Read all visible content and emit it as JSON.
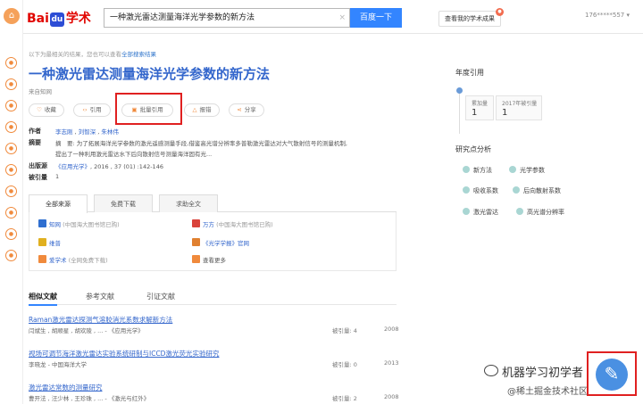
{
  "header": {
    "logo_bai": "Bai",
    "logo_du": "du",
    "logo_xueshu": "学术",
    "search_value": "一种激光雷达测量海洋光学参数的新方法",
    "search_button": "百度一下",
    "my_results": "查看我的学术成果",
    "user": "176*****557"
  },
  "hint": {
    "text": "以下为最相关的结果，您也可以查看",
    "link": "全部搜索结果"
  },
  "paper": {
    "title": "一种激光雷达测量海洋光学参数的新方法",
    "source": "来自知网",
    "actions": [
      "收藏",
      "引用",
      "批量引用",
      "报错",
      "分享"
    ],
    "authors_label": "作者",
    "authors": [
      "李志刚",
      "刘智深",
      "朱林伟"
    ],
    "abstract_label": "摘要",
    "abstract_line1": "摘　要: 为了拓展海洋光学参数的激光遥感测量手段,借鉴高光谱分辨率多普勒激光雷达对大气散射信号的测量机制,",
    "abstract_line2": "提出了一种利用激光雷达水下后向散射信号测量海洋固有光...",
    "pub_label": "出版源",
    "pub_journal": "《应用光学》",
    "pub_detail": ", 2016 , 37 (01) :142-146",
    "cited_label": "被引量",
    "cited_value": "1"
  },
  "sources": {
    "tabs": [
      "全部来源",
      "免费下载",
      "求助全文"
    ],
    "items": [
      {
        "name": "知网",
        "note": "(中国海大图书馆已购)",
        "color": "#2f6fd0"
      },
      {
        "name": "万方",
        "note": "(中国海大图书馆已购)",
        "color": "#d9423a"
      },
      {
        "name": "维普",
        "note": "",
        "color": "#e0b020"
      },
      {
        "name": "《光学学报》官网",
        "note": "",
        "color": "#e08030"
      },
      {
        "name": "爱学术",
        "note": "(全网免费下载)",
        "color": "#f08a3c"
      },
      {
        "name": "查看更多",
        "note": "",
        "color": "#f08a3c"
      }
    ]
  },
  "related": {
    "tabs": [
      "相似文献",
      "参考文献",
      "引证文献"
    ],
    "rows": [
      {
        "title": "Raman激光雷达探测气溶胶消光系数求解新方法",
        "sub": "闫斌生 , 胡顺星 , 胡欢陵 , ... - 《应用光学》",
        "cite": "被引量: 4",
        "year": "2008"
      },
      {
        "title": "视场可调节海洋激光雷达实验系统研制与ICCD激光荧光实验研究",
        "sub": "李晓龙 - 中国海洋大学",
        "cite": "被引量: 0",
        "year": "2013"
      },
      {
        "title": "激光雷达常数的测量研究",
        "sub": "曹开法 , 汪少林 , 王珍珠 , ... - 《激光与红外》",
        "cite": "被引量: 2",
        "year": "2008"
      }
    ]
  },
  "right": {
    "yearly_cite": "年度引用",
    "stats": [
      {
        "label": "累加量",
        "value": "1"
      },
      {
        "label": "2017年被引量",
        "value": "1"
      }
    ],
    "analysis": "研究点分析",
    "keywords": [
      "新方法",
      "光学参数",
      "吸收系数",
      "后向散射系数",
      "激光雷达",
      "高光谱分辨率"
    ]
  },
  "watermark": {
    "line1": "机器学习初学者",
    "line2": "@稀土掘金技术社区"
  }
}
